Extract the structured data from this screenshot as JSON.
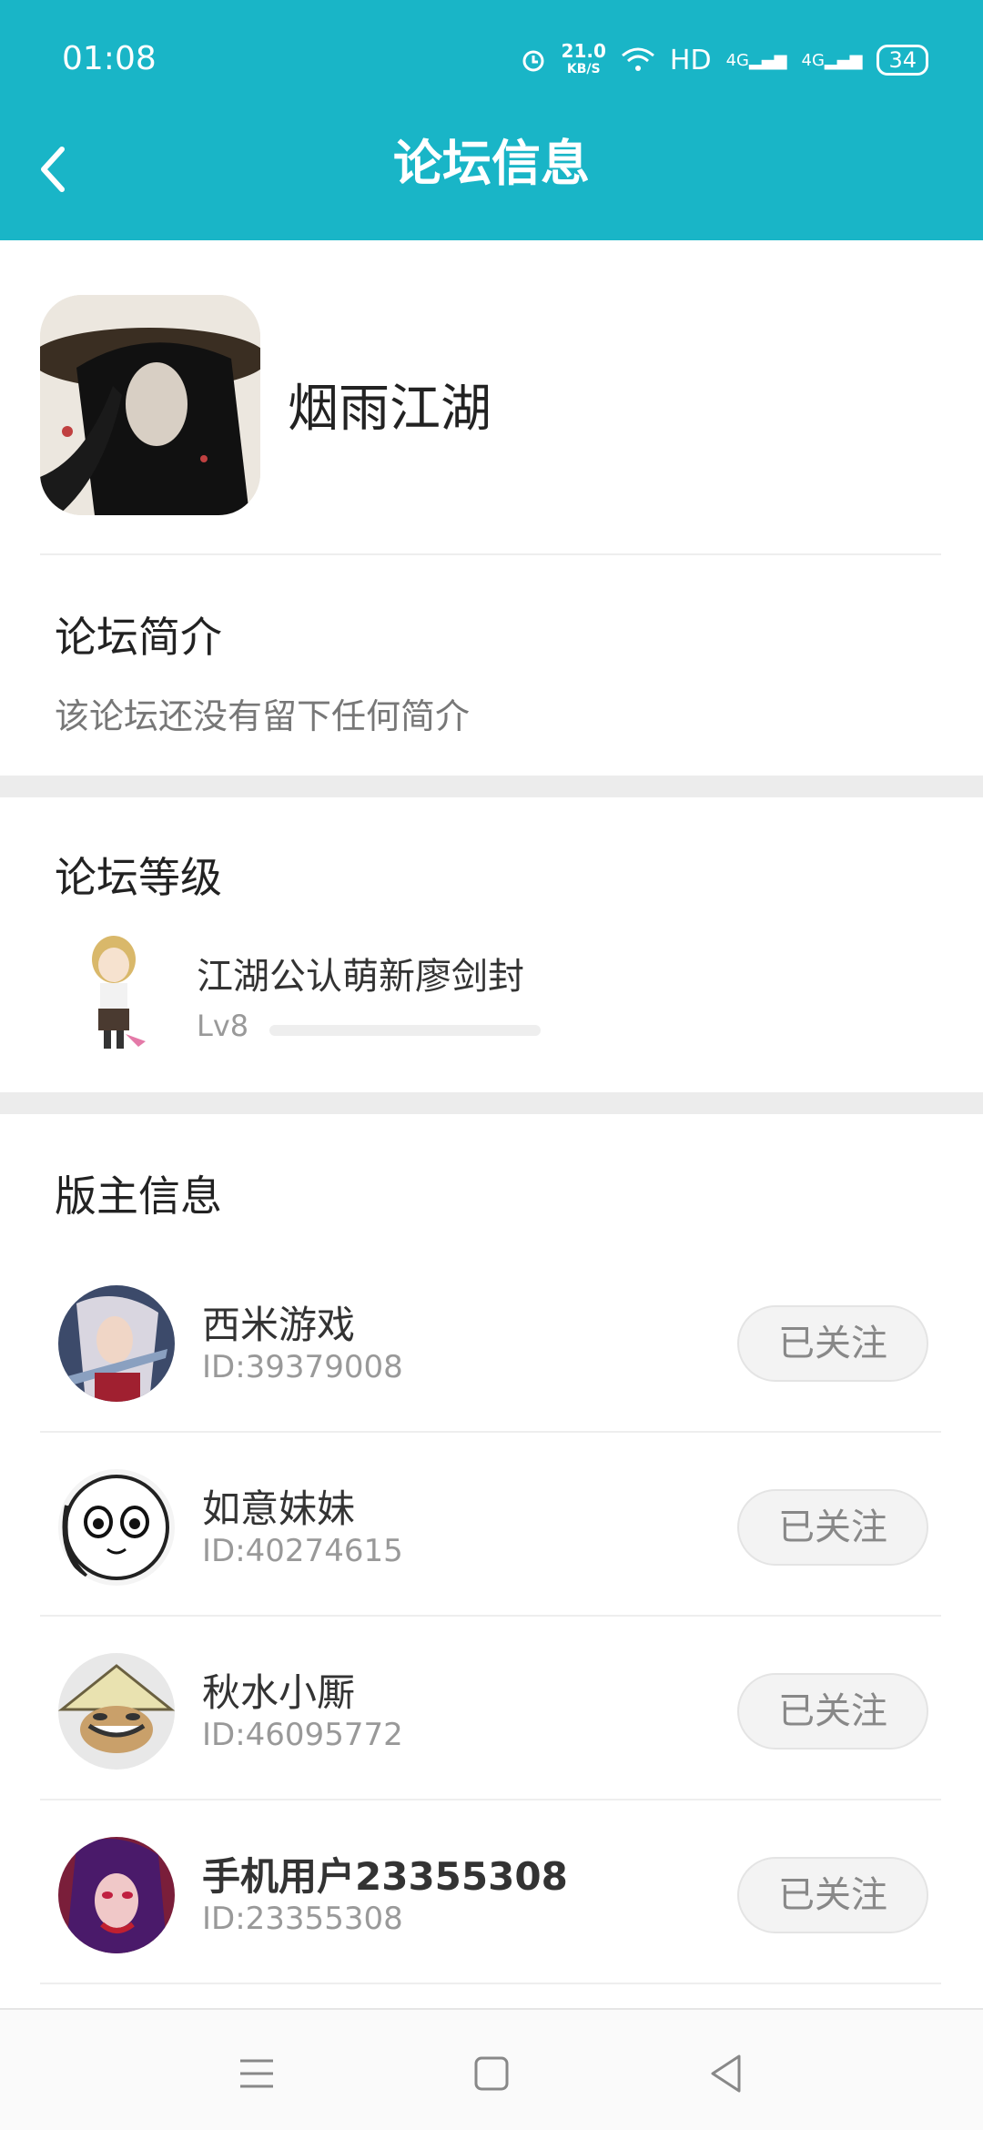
{
  "status_bar": {
    "time": "01:08",
    "speed_value": "21.0",
    "speed_unit": "KB/S",
    "hd": "HD",
    "net1": "4G",
    "net2": "4G",
    "battery": "34"
  },
  "header": {
    "title": "论坛信息"
  },
  "forum": {
    "name": "烟雨江湖"
  },
  "intro": {
    "title": "论坛简介",
    "text": "该论坛还没有留下任何简介"
  },
  "level": {
    "title": "论坛等级",
    "name": "江湖公认萌新廖剑封",
    "lv": "Lv8",
    "progress": 0
  },
  "moderators": {
    "title": "版主信息",
    "items": [
      {
        "name": "西米游戏",
        "id": "ID:39379008",
        "button": "已关注"
      },
      {
        "name": "如意妹妹",
        "id": "ID:40274615",
        "button": "已关注"
      },
      {
        "name": "秋水小厮",
        "id": "ID:46095772",
        "button": "已关注"
      },
      {
        "name": "手机用户23355308",
        "id": "ID:23355308",
        "button": "已关注"
      }
    ]
  },
  "colors": {
    "accent": "#19b5c7"
  }
}
